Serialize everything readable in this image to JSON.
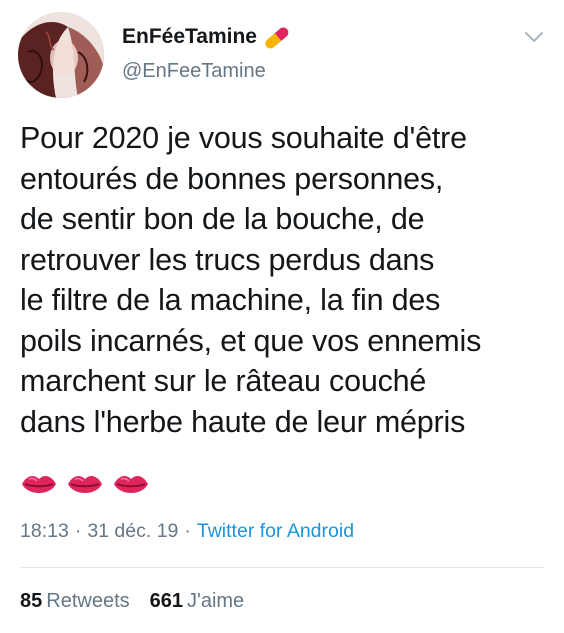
{
  "author": {
    "display_name": "EnFéeTamine",
    "handle": "@EnFeeTamine",
    "badge_icon": "pill-icon"
  },
  "tweet": {
    "text": "Pour 2020 je vous souhaite d'être\nentourés de bonnes personnes,\nde sentir bon de la bouche, de\nretrouver les trucs perdus dans\nle filtre de la machine, la fin des\npoils incarnés, et que vos ennemis\nmarchent sur le râteau couché\ndans l'herbe haute de leur mépris",
    "emojis": [
      "lips-icon",
      "lips-icon",
      "lips-icon"
    ],
    "time": "18:13",
    "date": "31 déc. 19",
    "separator": "·",
    "source": "Twitter for Android"
  },
  "stats": {
    "retweets_count": "85",
    "retweets_label": "Retweets",
    "likes_count": "661",
    "likes_label": "J'aime"
  },
  "colors": {
    "text": "#14171a",
    "secondary": "#657786",
    "link": "#1b95e0",
    "divider": "#e1e8ed"
  }
}
